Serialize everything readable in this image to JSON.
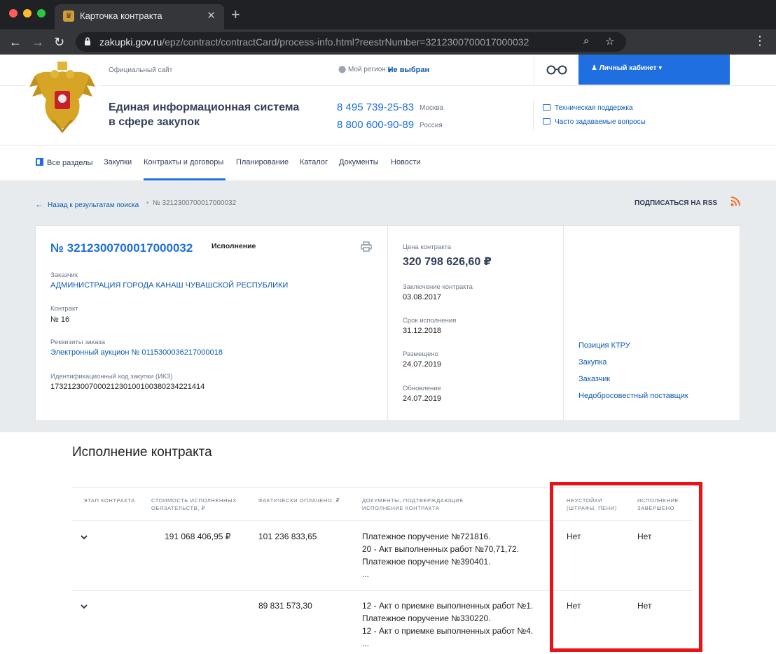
{
  "browser": {
    "tab_title": "Карточка контракта",
    "url_host": "zakupki.gov.ru",
    "url_path": "/epz/contract/contractCard/process-info.html?reestrNumber=3212300700017000032"
  },
  "header": {
    "official_label": "Официальный сайт",
    "region_label": "Мой регион:",
    "region_value": "Не выбран",
    "cabinet_label": "Личный кабинет",
    "site_title_line1": "Единая информационная система",
    "site_title_line2": "в сфере закупок",
    "phone1": "8 495 739-25-83",
    "phone1_city": "Москва",
    "phone2": "8 800 600-90-89",
    "phone2_city": "Россия",
    "support_link": "Техническая поддержка",
    "faq_link": "Часто задаваемые вопросы"
  },
  "nav": {
    "items": [
      "Все разделы",
      "Закупки",
      "Контракты и договоры",
      "Планирование",
      "Каталог",
      "Документы",
      "Новости"
    ]
  },
  "breadcrumb": {
    "back_label": "Назад к результатам поиска",
    "separator": "•",
    "number": "№ 3212300700017000032",
    "rss_label": "ПОДПИСАТЬСЯ НА RSS"
  },
  "contract": {
    "number": "№ 3212300700017000032",
    "status": "Исполнение",
    "customer_label": "Заказчик",
    "customer": "АДМИНИСТРАЦИЯ ГОРОДА КАНАШ ЧУВАШСКОЙ РЕСПУБЛИКИ",
    "contract_label": "Контракт",
    "contract_value": "№ 16",
    "requisites_label": "Реквизиты заказа",
    "requisites_value": "Электронный аукцион № 0115300036217000018",
    "ikz_label": "Идентификационный код закупки (ИКЗ)",
    "ikz_value": "173212300700021230100100380234221414",
    "price_label": "Цена контракта",
    "price_value": "320 798 626,60 ₽",
    "conclusion_label": "Заключение контракта",
    "conclusion_value": "03.08.2017",
    "term_label": "Срок исполнения",
    "term_value": "31.12.2018",
    "placed_label": "Размещено",
    "placed_value": "24.07.2019",
    "updated_label": "Обновление",
    "updated_value": "24.07.2019",
    "side_links": [
      "Позиция КТРУ",
      "Закупка",
      "Заказчик",
      "Недобросовестный поставщик"
    ]
  },
  "execution": {
    "title": "Исполнение контракта",
    "headers": {
      "stage": "Этап контракта",
      "cost_1": "Стоимость исполненных",
      "cost_2": "обязательств, ₽",
      "paid": "Фактически оплачено, ₽",
      "docs_1": "Документы, подтверждающие",
      "docs_2": "исполнение контракта",
      "penalty_1": "Неустойки",
      "penalty_2": "(штрафы, пени)",
      "done_1": "Исполнение",
      "done_2": "завершено"
    },
    "rows": [
      {
        "cost": "191 068 406,95 ₽",
        "paid": "101 236 833,65",
        "docs": [
          "Платежное поручение №721816.",
          "20 - Акт выполненных работ №70,71,72.",
          "Платежное поручение №390401.",
          "..."
        ],
        "penalty": "Нет",
        "done": "Нет"
      },
      {
        "cost": "",
        "paid": "89 831 573,30",
        "docs": [
          "12 - Акт о приемке выполненных работ №1.",
          "Платежное поручение №330220.",
          "12 - Акт о приемке выполненных работ №4.",
          "..."
        ],
        "penalty": "Нет",
        "done": "Нет"
      }
    ]
  },
  "colors": {
    "brand_blue": "#1f6fe0",
    "link_blue": "#0c5ab0",
    "highlight_red": "#e8131a"
  },
  "icons": [
    "lock-icon",
    "back-arrow-icon",
    "forward-arrow-icon",
    "reload-icon",
    "zoom-icon",
    "star-icon",
    "glasses-icon",
    "user-icon",
    "location-icon",
    "mail-icon",
    "faq-icon",
    "grid-icon",
    "rss-icon",
    "print-icon",
    "chevron-down-icon"
  ]
}
